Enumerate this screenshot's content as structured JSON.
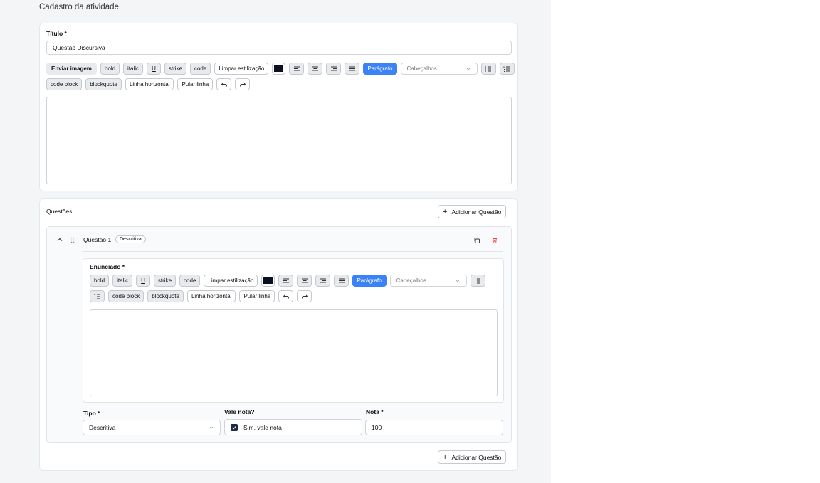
{
  "page_title": "Cadastro da atividade",
  "titulo": {
    "label": "Título *",
    "value": "Questão Discursiva"
  },
  "toolbar": {
    "send_image": "Enviar imagem",
    "bold": "bold",
    "italic": "italic",
    "underline": "U",
    "strike": "strike",
    "code": "code",
    "clear": "Limpar estilização",
    "paragraph": "Parágrafo",
    "headings": "Cabeçalhos",
    "code_block": "code block",
    "blockquote": "blockquote",
    "hr": "Linha horizontal",
    "line_break": "Pular linha",
    "color": "#0b1020"
  },
  "questoes": {
    "label": "Questões",
    "add_button": "Adicionar Questão",
    "items": [
      {
        "title": "Questão 1",
        "badge": "Descritiva",
        "enunciado_label": "Enunciado *",
        "tipo_label": "Tipo *",
        "tipo_value": "Descritiva",
        "vale_nota_label": "Vale nota?",
        "vale_nota_text": "Sim, vale nota",
        "vale_nota_checked": true,
        "nota_label": "Nota *",
        "nota_value": "100"
      }
    ]
  },
  "colors": {
    "accent": "#3b82f6",
    "delete": "#ef4444",
    "checkbox": "#1f2a44"
  }
}
